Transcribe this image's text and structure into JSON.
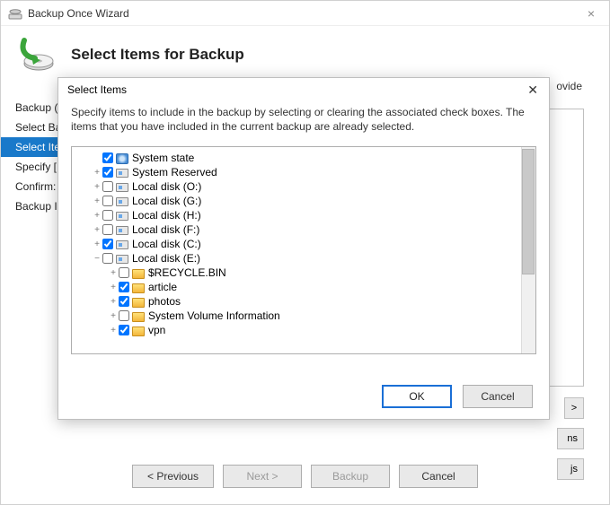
{
  "outer": {
    "title": "Backup Once Wizard",
    "heading": "Select Items for Backup",
    "ovide_fragment": "ovide",
    "steps": [
      "Backup (",
      "Select Ba",
      "Select Ite",
      "Specify [",
      "Confirm:",
      "Backup I"
    ],
    "active_step_index": 2,
    "side_buttons": {
      "scroll": ">",
      "ns": "ns",
      "js": "js"
    },
    "footer": {
      "previous": "< Previous",
      "next": "Next >",
      "backup": "Backup",
      "cancel": "Cancel"
    }
  },
  "modal": {
    "title": "Select Items",
    "description": "Specify items to include in the backup by selecting or clearing the associated check boxes. The items that you have included in the current backup are already selected.",
    "ok": "OK",
    "cancel": "Cancel"
  },
  "tree": {
    "root": [
      {
        "expander": "",
        "checked": true,
        "icon": "sys",
        "label": "System state"
      },
      {
        "expander": "+",
        "checked": true,
        "icon": "drive",
        "label": "System Reserved"
      },
      {
        "expander": "+",
        "checked": false,
        "icon": "drive",
        "label": "Local disk (O:)"
      },
      {
        "expander": "+",
        "checked": false,
        "icon": "drive",
        "label": "Local disk (G:)"
      },
      {
        "expander": "+",
        "checked": false,
        "icon": "drive",
        "label": "Local disk (H:)"
      },
      {
        "expander": "+",
        "checked": false,
        "icon": "drive",
        "label": "Local disk (F:)"
      },
      {
        "expander": "+",
        "checked": true,
        "icon": "drive",
        "label": "Local disk (C:)"
      },
      {
        "expander": "−",
        "checked": false,
        "icon": "drive",
        "label": "Local disk (E:)"
      }
    ],
    "children_e": [
      {
        "expander": "+",
        "checked": false,
        "icon": "folder",
        "label": "$RECYCLE.BIN"
      },
      {
        "expander": "+",
        "checked": true,
        "icon": "folder",
        "label": "article"
      },
      {
        "expander": "+",
        "checked": true,
        "icon": "folder",
        "label": "photos"
      },
      {
        "expander": "+",
        "checked": false,
        "icon": "folder",
        "label": "System Volume Information"
      },
      {
        "expander": "+",
        "checked": true,
        "icon": "folder",
        "label": "vpn"
      }
    ]
  }
}
